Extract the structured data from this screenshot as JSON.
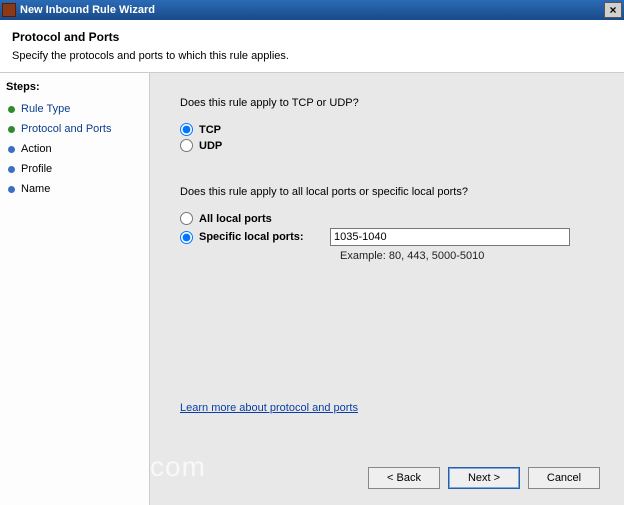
{
  "window": {
    "title": "New Inbound Rule Wizard",
    "close": "×"
  },
  "header": {
    "title": "Protocol and Ports",
    "subtitle": "Specify the protocols and ports to which this rule applies."
  },
  "sidebar": {
    "label": "Steps:",
    "items": [
      {
        "label": "Rule Type",
        "state": "done"
      },
      {
        "label": "Protocol and Ports",
        "state": "current"
      },
      {
        "label": "Action",
        "state": "pending"
      },
      {
        "label": "Profile",
        "state": "pending"
      },
      {
        "label": "Name",
        "state": "pending"
      }
    ]
  },
  "main": {
    "q1": "Does this rule apply to TCP or UDP?",
    "proto": {
      "tcp": "TCP",
      "udp": "UDP",
      "selected": "tcp"
    },
    "q2": "Does this rule apply to all local ports or specific local ports?",
    "ports": {
      "all_label": "All local ports",
      "specific_label": "Specific local ports:",
      "selected": "specific",
      "value": "1035-1040",
      "example": "Example: 80, 443, 5000-5010"
    },
    "learn": "Learn more about protocol and ports"
  },
  "buttons": {
    "back": "< Back",
    "next": "Next >",
    "cancel": "Cancel"
  },
  "watermark": "com"
}
